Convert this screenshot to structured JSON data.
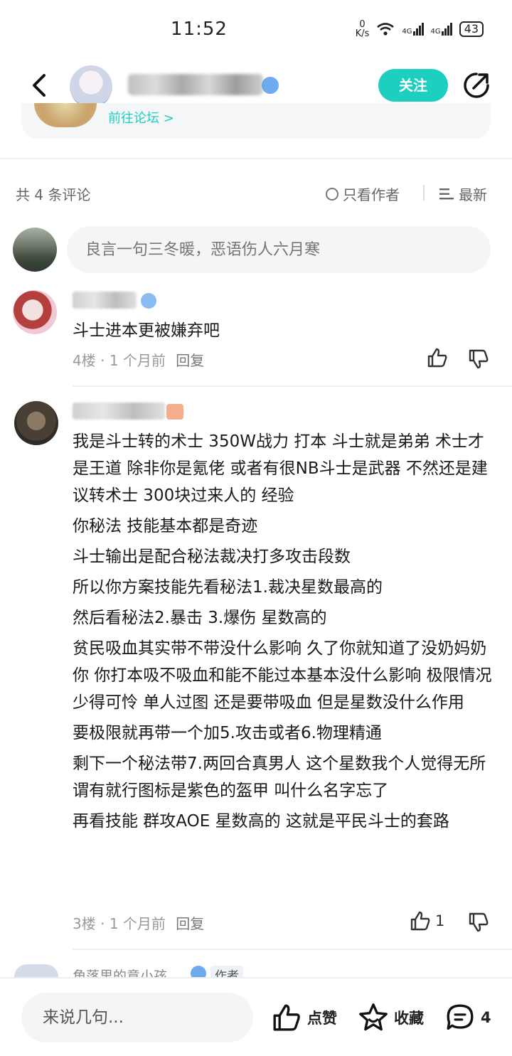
{
  "status": {
    "time": "11:52",
    "net_speed_top": "0",
    "net_speed_bottom": "K/s",
    "battery": "43",
    "sig1": "4G",
    "sig2": "4G"
  },
  "header": {
    "follow_label": "关注"
  },
  "forum_card": {
    "link_label": "前往论坛 >"
  },
  "comments_header": {
    "count_label": "共 4 条评论",
    "only_author_label": "只看作者",
    "sort_label": "最新"
  },
  "compose": {
    "placeholder": "良言一句三冬暖，恶语伤人六月寒"
  },
  "comments": [
    {
      "floor": "4楼",
      "time": "1 个月前",
      "reply_label": "回复",
      "like_count": "",
      "paragraphs": [
        "斗士进本更被嫌弃吧"
      ]
    },
    {
      "floor": "3楼",
      "time": "1 个月前",
      "reply_label": "回复",
      "like_count": "1",
      "paragraphs": [
        "我是斗士转的术士  350W战力  打本  斗士就是弟弟  术士才是王道  除非你是氪佬 或者有很NB斗士是武器  不然还是建议转术士 300块过来人的 经验",
        "你秘法 技能基本都是奇迹",
        "斗士输出是配合秘法裁决打多攻击段数",
        "所以你方案技能先看秘法1.裁决星数最高的",
        "然后看秘法2.暴击 3.爆伤 星数高的",
        "贫民吸血其实带不带没什么影响 久了你就知道了没奶妈奶你  你打本吸不吸血和能不能过本基本没什么影响 极限情况少得可怜  单人过图 还是要带吸血 但是星数没什么作用",
        "要极限就再带一个加5.攻击或者6.物理精通",
        "剩下一个秘法带7.两回合真男人 这个星数我个人觉得无所谓有就行图标是紫色的盔甲  叫什么名字忘了",
        "再看技能 群攻AOE 星数高的  这就是平民斗士的套路"
      ]
    },
    {
      "name": "角落里的意小孩",
      "author_badge": "作者"
    }
  ],
  "bottom_bar": {
    "input_label": "来说几句...",
    "like_label": "点赞",
    "fav_label": "收藏",
    "comment_count": "4"
  },
  "colors": {
    "accent": "#1ccfc1",
    "muted": "#999999"
  }
}
